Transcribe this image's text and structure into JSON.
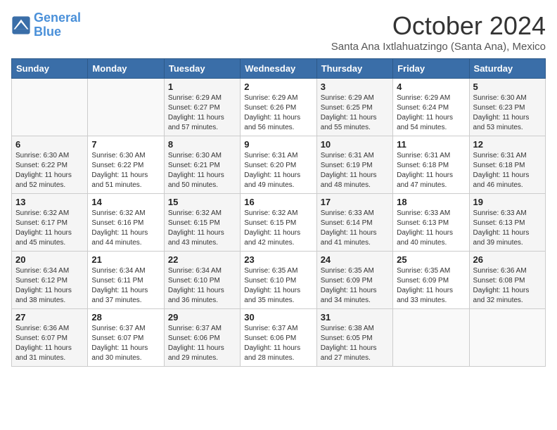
{
  "header": {
    "logo_line1": "General",
    "logo_line2": "Blue",
    "month": "October 2024",
    "location": "Santa Ana Ixtlahuatzingo (Santa Ana), Mexico"
  },
  "weekdays": [
    "Sunday",
    "Monday",
    "Tuesday",
    "Wednesday",
    "Thursday",
    "Friday",
    "Saturday"
  ],
  "weeks": [
    [
      {
        "day": "",
        "info": ""
      },
      {
        "day": "",
        "info": ""
      },
      {
        "day": "1",
        "info": "Sunrise: 6:29 AM\nSunset: 6:27 PM\nDaylight: 11 hours\nand 57 minutes."
      },
      {
        "day": "2",
        "info": "Sunrise: 6:29 AM\nSunset: 6:26 PM\nDaylight: 11 hours\nand 56 minutes."
      },
      {
        "day": "3",
        "info": "Sunrise: 6:29 AM\nSunset: 6:25 PM\nDaylight: 11 hours\nand 55 minutes."
      },
      {
        "day": "4",
        "info": "Sunrise: 6:29 AM\nSunset: 6:24 PM\nDaylight: 11 hours\nand 54 minutes."
      },
      {
        "day": "5",
        "info": "Sunrise: 6:30 AM\nSunset: 6:23 PM\nDaylight: 11 hours\nand 53 minutes."
      }
    ],
    [
      {
        "day": "6",
        "info": "Sunrise: 6:30 AM\nSunset: 6:22 PM\nDaylight: 11 hours\nand 52 minutes."
      },
      {
        "day": "7",
        "info": "Sunrise: 6:30 AM\nSunset: 6:22 PM\nDaylight: 11 hours\nand 51 minutes."
      },
      {
        "day": "8",
        "info": "Sunrise: 6:30 AM\nSunset: 6:21 PM\nDaylight: 11 hours\nand 50 minutes."
      },
      {
        "day": "9",
        "info": "Sunrise: 6:31 AM\nSunset: 6:20 PM\nDaylight: 11 hours\nand 49 minutes."
      },
      {
        "day": "10",
        "info": "Sunrise: 6:31 AM\nSunset: 6:19 PM\nDaylight: 11 hours\nand 48 minutes."
      },
      {
        "day": "11",
        "info": "Sunrise: 6:31 AM\nSunset: 6:18 PM\nDaylight: 11 hours\nand 47 minutes."
      },
      {
        "day": "12",
        "info": "Sunrise: 6:31 AM\nSunset: 6:18 PM\nDaylight: 11 hours\nand 46 minutes."
      }
    ],
    [
      {
        "day": "13",
        "info": "Sunrise: 6:32 AM\nSunset: 6:17 PM\nDaylight: 11 hours\nand 45 minutes."
      },
      {
        "day": "14",
        "info": "Sunrise: 6:32 AM\nSunset: 6:16 PM\nDaylight: 11 hours\nand 44 minutes."
      },
      {
        "day": "15",
        "info": "Sunrise: 6:32 AM\nSunset: 6:15 PM\nDaylight: 11 hours\nand 43 minutes."
      },
      {
        "day": "16",
        "info": "Sunrise: 6:32 AM\nSunset: 6:15 PM\nDaylight: 11 hours\nand 42 minutes."
      },
      {
        "day": "17",
        "info": "Sunrise: 6:33 AM\nSunset: 6:14 PM\nDaylight: 11 hours\nand 41 minutes."
      },
      {
        "day": "18",
        "info": "Sunrise: 6:33 AM\nSunset: 6:13 PM\nDaylight: 11 hours\nand 40 minutes."
      },
      {
        "day": "19",
        "info": "Sunrise: 6:33 AM\nSunset: 6:13 PM\nDaylight: 11 hours\nand 39 minutes."
      }
    ],
    [
      {
        "day": "20",
        "info": "Sunrise: 6:34 AM\nSunset: 6:12 PM\nDaylight: 11 hours\nand 38 minutes."
      },
      {
        "day": "21",
        "info": "Sunrise: 6:34 AM\nSunset: 6:11 PM\nDaylight: 11 hours\nand 37 minutes."
      },
      {
        "day": "22",
        "info": "Sunrise: 6:34 AM\nSunset: 6:10 PM\nDaylight: 11 hours\nand 36 minutes."
      },
      {
        "day": "23",
        "info": "Sunrise: 6:35 AM\nSunset: 6:10 PM\nDaylight: 11 hours\nand 35 minutes."
      },
      {
        "day": "24",
        "info": "Sunrise: 6:35 AM\nSunset: 6:09 PM\nDaylight: 11 hours\nand 34 minutes."
      },
      {
        "day": "25",
        "info": "Sunrise: 6:35 AM\nSunset: 6:09 PM\nDaylight: 11 hours\nand 33 minutes."
      },
      {
        "day": "26",
        "info": "Sunrise: 6:36 AM\nSunset: 6:08 PM\nDaylight: 11 hours\nand 32 minutes."
      }
    ],
    [
      {
        "day": "27",
        "info": "Sunrise: 6:36 AM\nSunset: 6:07 PM\nDaylight: 11 hours\nand 31 minutes."
      },
      {
        "day": "28",
        "info": "Sunrise: 6:37 AM\nSunset: 6:07 PM\nDaylight: 11 hours\nand 30 minutes."
      },
      {
        "day": "29",
        "info": "Sunrise: 6:37 AM\nSunset: 6:06 PM\nDaylight: 11 hours\nand 29 minutes."
      },
      {
        "day": "30",
        "info": "Sunrise: 6:37 AM\nSunset: 6:06 PM\nDaylight: 11 hours\nand 28 minutes."
      },
      {
        "day": "31",
        "info": "Sunrise: 6:38 AM\nSunset: 6:05 PM\nDaylight: 11 hours\nand 27 minutes."
      },
      {
        "day": "",
        "info": ""
      },
      {
        "day": "",
        "info": ""
      }
    ]
  ]
}
